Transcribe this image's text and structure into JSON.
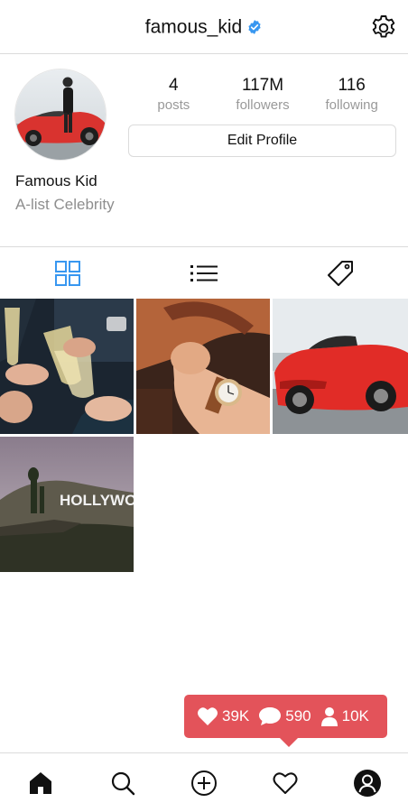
{
  "header": {
    "username": "famous_kid",
    "verified_icon": "verified-badge-icon",
    "settings_icon": "gear-icon"
  },
  "profile": {
    "stats": [
      {
        "value": "4",
        "label": "posts"
      },
      {
        "value": "117M",
        "label": "followers"
      },
      {
        "value": "116",
        "label": "following"
      }
    ],
    "edit_button": "Edit Profile",
    "full_name": "Famous Kid",
    "bio": "A-list Celebrity"
  },
  "tabs": [
    {
      "icon": "grid-icon",
      "active": true
    },
    {
      "icon": "list-icon",
      "active": false
    },
    {
      "icon": "tag-icon",
      "active": false
    }
  ],
  "posts": [
    {
      "subject": "champagne-toast"
    },
    {
      "subject": "wristwatch-steering-wheel"
    },
    {
      "subject": "red-sports-car"
    },
    {
      "subject": "hollywood-sign"
    }
  ],
  "activity": {
    "likes": "39K",
    "comments": "590",
    "followers": "10K"
  },
  "bottom_nav": [
    "home-icon",
    "search-icon",
    "add-icon",
    "heart-icon",
    "profile-icon"
  ],
  "colors": {
    "accent": "#3897f0",
    "popup": "#e3535a",
    "border": "#dbdbdb",
    "muted": "#8e8e8e"
  }
}
